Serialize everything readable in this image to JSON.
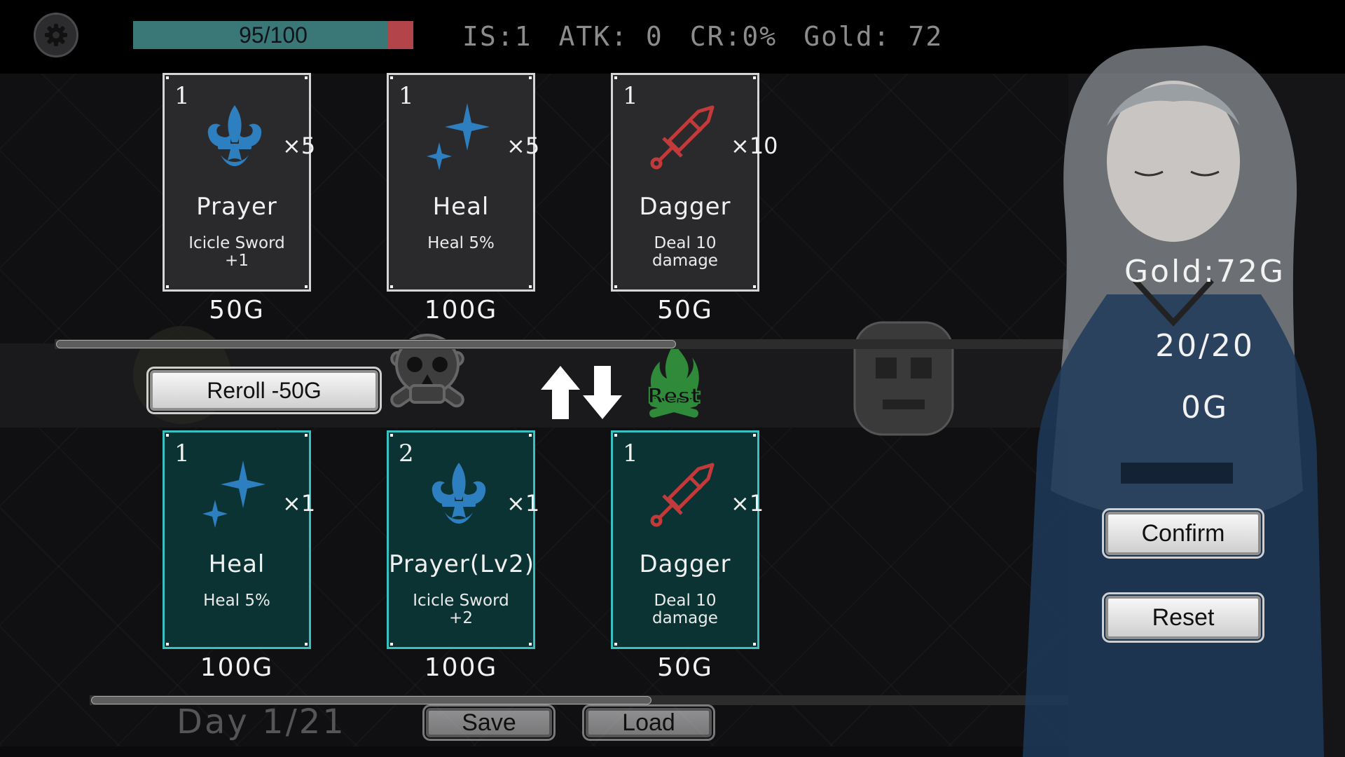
{
  "hud": {
    "hp_text": "95/100",
    "hp_fraction": 0.95,
    "stats": [
      "IS:1",
      "ATK: 0",
      "CR:0%",
      "Gold: 72"
    ]
  },
  "shop_cards": [
    {
      "level": "1",
      "icon": "fleur-de-lis-icon",
      "mult": "×5",
      "name": "Prayer",
      "desc": "Icicle Sword\n+1",
      "price": "50G"
    },
    {
      "level": "1",
      "icon": "sparkle-icon",
      "mult": "×5",
      "name": "Heal",
      "desc": "Heal 5%",
      "price": "100G"
    },
    {
      "level": "1",
      "icon": "dagger-icon",
      "mult": "×10",
      "name": "Dagger",
      "desc": "Deal 10 damage",
      "price": "50G"
    }
  ],
  "owned_cards": [
    {
      "level": "1",
      "icon": "sparkle-icon",
      "mult": "×1",
      "name": "Heal",
      "desc": "Heal 5%",
      "price": "100G"
    },
    {
      "level": "2",
      "icon": "fleur-de-lis-icon",
      "mult": "×1",
      "name": "Prayer(Lv2)",
      "desc": "Icicle Sword\n+2",
      "price": "100G"
    },
    {
      "level": "1",
      "icon": "dagger-icon",
      "mult": "×1",
      "name": "Dagger",
      "desc": "Deal 10 damage",
      "price": "50G"
    }
  ],
  "reroll_label": "Reroll -50G",
  "map_labels": {
    "rest": "Rest"
  },
  "side": {
    "gold": "Gold:72G",
    "count": "20/20",
    "cost": "0G",
    "confirm_label": "Confirm",
    "reset_label": "Reset"
  },
  "footer": {
    "day": "Day 1/21",
    "save_label": "Save",
    "load_label": "Load"
  },
  "colors": {
    "hp_fill": "#3a7777",
    "hp_lost": "#b3454a",
    "owned_card_bg": "#0c3333",
    "owned_card_border": "#3ac0c0",
    "icon_blue": "#2e7fc0",
    "icon_red": "#c23a3a",
    "rest_green": "#2f8a3a"
  }
}
